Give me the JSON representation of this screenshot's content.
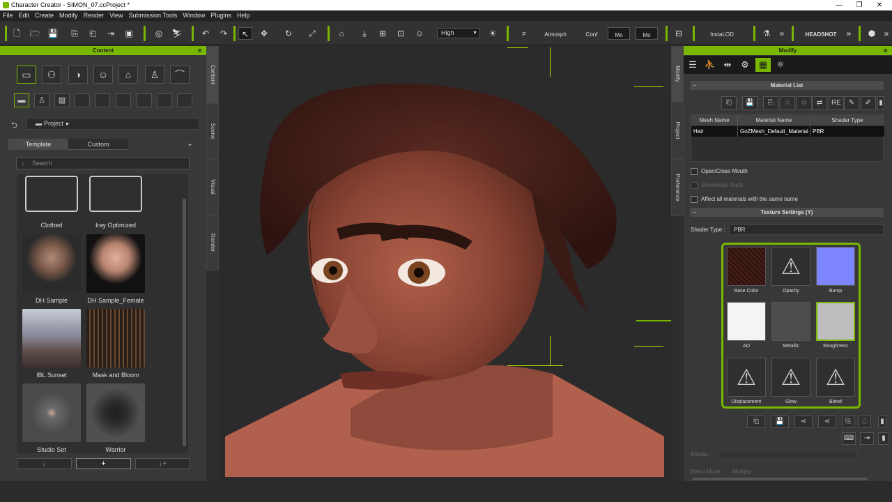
{
  "window": {
    "title": "Character Creator - SIMON_07.ccProject *",
    "minimize": "—",
    "maximize": "❐",
    "close": "✕"
  },
  "menu": [
    "File",
    "Edit",
    "Create",
    "Modify",
    "Render",
    "View",
    "Submission Tools",
    "Window",
    "Plugins",
    "Help"
  ],
  "toolbar": {
    "quality": "High",
    "atmosphere_label": "Atmosph",
    "p_label": "P",
    "conf_label": "Conf",
    "mo_label": "Mo",
    "mo2_label": "Mo",
    "instalod_label": "InstaLOD",
    "headshot_label": "HEADSHOT"
  },
  "content_panel": {
    "title": "Content",
    "breadcrumb": "Project",
    "tabs": {
      "template": "Template",
      "custom": "Custom"
    },
    "search_placeholder": "Search",
    "items": [
      {
        "label": "Clothed",
        "kind": "folder"
      },
      {
        "label": "Iray Optimized",
        "kind": "folder"
      },
      {
        "label": "DH Sample",
        "kind": "image",
        "color": "#6b4a3a"
      },
      {
        "label": "DH Sample_Female",
        "kind": "image",
        "color": "#8a6050"
      },
      {
        "label": "IBL Sunset",
        "kind": "image",
        "color": "#5a5560"
      },
      {
        "label": "Mask and Bloom",
        "kind": "image",
        "color": "#3a2a22"
      },
      {
        "label": "Studio Set",
        "kind": "image",
        "color": "#4a4a4a"
      },
      {
        "label": "Warrior",
        "kind": "image",
        "color": "#3c3c3c"
      }
    ],
    "bottom_buttons": {
      "down": "↓",
      "add": "+",
      "replace": "↓+"
    }
  },
  "side_tabs_left": [
    "Content",
    "Scene",
    "Visual",
    "Render"
  ],
  "side_tabs_right": [
    "Modify",
    "Project",
    "Preference"
  ],
  "modify_panel": {
    "title": "Modify",
    "material_list_title": "Material List",
    "columns": [
      "Mesh Name",
      "Material Name",
      "Shader Type"
    ],
    "rows": [
      [
        "Hair",
        "GoZMesh_Default_Material",
        "PBR"
      ]
    ],
    "checkboxes": {
      "open_mouth": "Open/Close Mouth",
      "show_teeth": "Show/Hide Teeth",
      "affect_all": "Affect all materials with the same name"
    },
    "texture_settings_title": "Texture Settings  (Y)",
    "shader_type_label": "Shader Type :",
    "shader_type_value": "PBR",
    "textures": [
      {
        "label": "Base Color",
        "kind": "swatch",
        "color": "#3a1c16"
      },
      {
        "label": "Opacity",
        "kind": "warning"
      },
      {
        "label": "Bump",
        "kind": "swatch",
        "color": "#7e86ff"
      },
      {
        "label": "AO",
        "kind": "swatch",
        "color": "#f4f4f4"
      },
      {
        "label": "Metallic",
        "kind": "swatch",
        "color": "#4c4c4c"
      },
      {
        "label": "Roughness",
        "kind": "swatch",
        "color": "#bdbdbd"
      },
      {
        "label": "Displacement",
        "kind": "warning"
      },
      {
        "label": "Glow",
        "kind": "warning"
      },
      {
        "label": "Blend",
        "kind": "warning"
      }
    ],
    "bitmap_label": "Bitmap :",
    "blend_mode_label": "Blend Mode :",
    "blend_mode_value": "Multiply"
  },
  "accent_color": "#7ab800"
}
